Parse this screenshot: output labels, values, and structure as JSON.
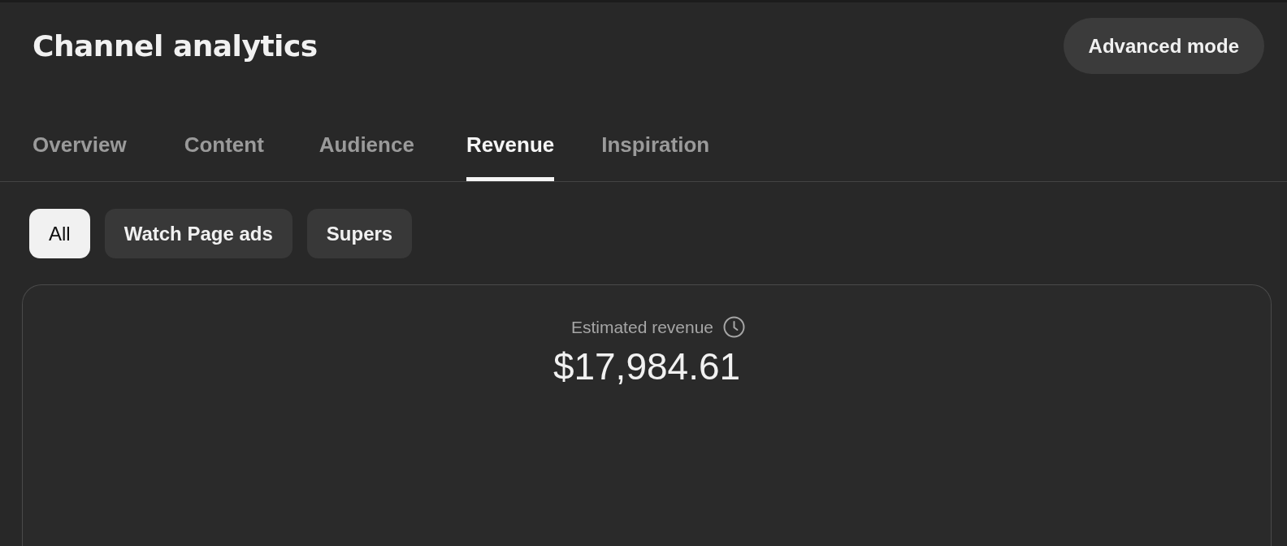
{
  "header": {
    "title": "Channel analytics",
    "advanced_mode_button": "Advanced mode"
  },
  "tabs": [
    {
      "label": "Overview",
      "selected": false
    },
    {
      "label": "Content",
      "selected": false
    },
    {
      "label": "Audience",
      "selected": false
    },
    {
      "label": "Revenue",
      "selected": true
    },
    {
      "label": "Inspiration",
      "selected": false
    }
  ],
  "filter_chips": [
    {
      "label": "All",
      "selected": true
    },
    {
      "label": "Watch Page ads",
      "selected": false
    },
    {
      "label": "Supers",
      "selected": false
    }
  ],
  "revenue_card": {
    "label": "Estimated revenue",
    "value": "$17,984.61"
  }
}
